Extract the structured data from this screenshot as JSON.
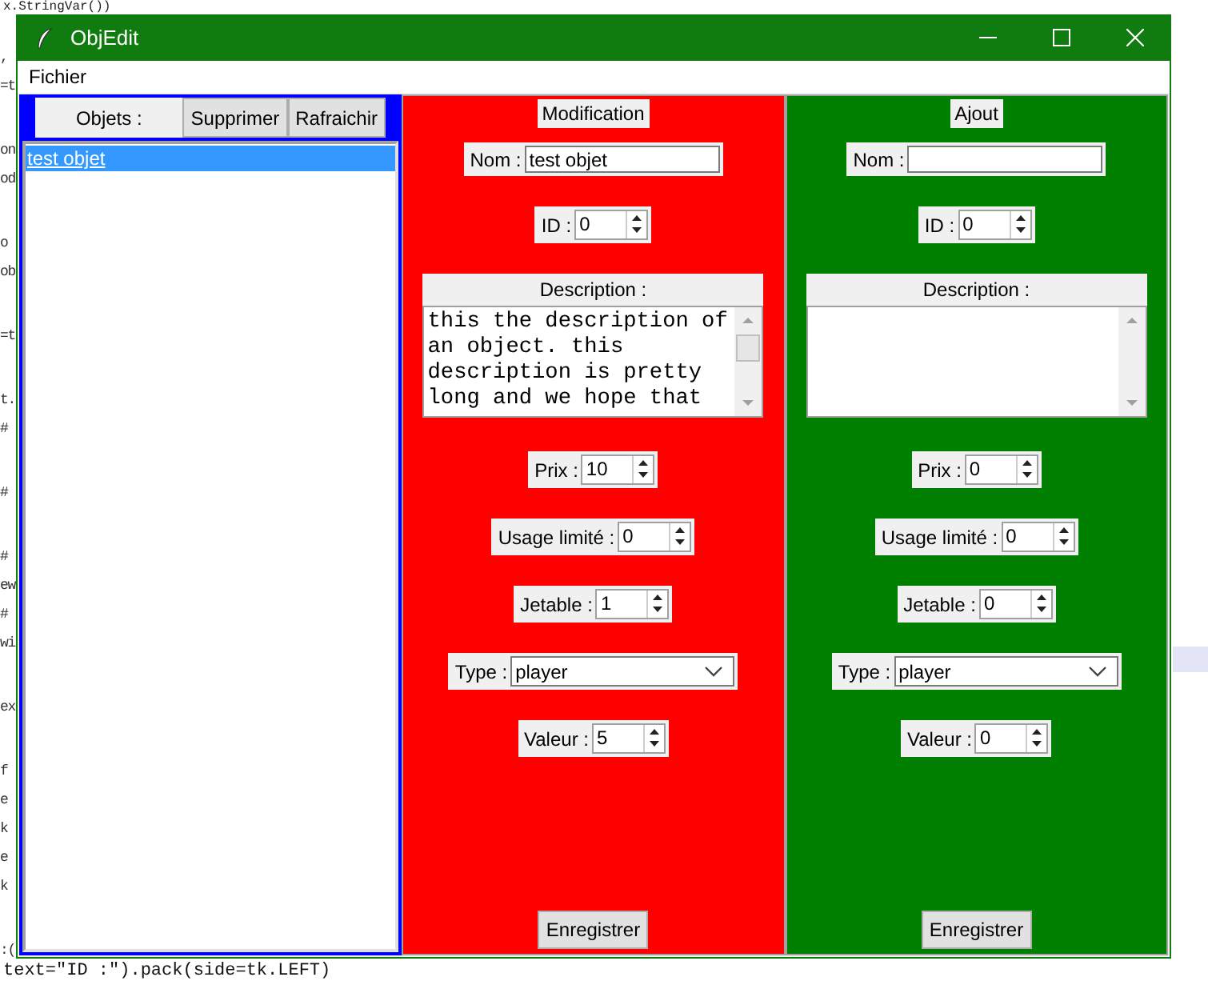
{
  "editor": {
    "top_line": "x.StringVar())",
    "side_fragment_groups": [
      [
        ",",
        "=t"
      ],
      [
        "on",
        "od"
      ],
      [
        "o",
        "ob"
      ],
      [
        "=t"
      ],
      [
        "t.",
        "#"
      ],
      [
        "#"
      ],
      [
        "#",
        "ew",
        "#",
        "wi"
      ],
      [
        "ex"
      ],
      [
        "f",
        "e",
        "k",
        "e",
        "k"
      ],
      [
        ":("
      ]
    ],
    "bottom_line": "text=\"ID :\").pack(side=tk.LEFT)"
  },
  "window": {
    "title": "ObjEdit"
  },
  "menu": [
    "Fichier"
  ],
  "objects_panel": {
    "label": "Objets :",
    "buttons": [
      "Supprimer",
      "Rafraichir"
    ],
    "items": [
      {
        "label": "test objet",
        "selected": true
      }
    ]
  },
  "forms": [
    {
      "title": "Modification",
      "color": "#ff0000",
      "fields": [
        {
          "kind": "entry",
          "label": "Nom :",
          "value": "test objet"
        },
        {
          "kind": "spinbox",
          "label": "ID :",
          "value": "0"
        },
        {
          "kind": "text",
          "label": "Description :",
          "value": "this the description of an object. this description is pretty long and we hope that"
        },
        {
          "kind": "spinbox",
          "label": "Prix :",
          "value": "10"
        },
        {
          "kind": "spinbox",
          "label": "Usage limité :",
          "value": "0"
        },
        {
          "kind": "spinbox",
          "label": "Jetable :",
          "value": "1"
        },
        {
          "kind": "combo",
          "label": "Type :",
          "value": "player"
        },
        {
          "kind": "spinbox",
          "label": "Valeur :",
          "value": "5"
        }
      ],
      "button": "Enregistrer"
    },
    {
      "title": "Ajout",
      "color": "#008000",
      "fields": [
        {
          "kind": "entry",
          "label": "Nom :"
        },
        {
          "kind": "spinbox",
          "label": "ID :",
          "value": "0"
        },
        {
          "kind": "text",
          "label": "Description :"
        },
        {
          "kind": "spinbox",
          "label": "Prix :",
          "value": "0"
        },
        {
          "kind": "spinbox",
          "label": "Usage limité :",
          "value": "0"
        },
        {
          "kind": "spinbox",
          "label": "Jetable :",
          "value": "0"
        },
        {
          "kind": "combo",
          "label": "Type :",
          "value": "player"
        },
        {
          "kind": "spinbox",
          "label": "Valeur :",
          "value": "0"
        }
      ],
      "button": "Enregistrer"
    }
  ]
}
